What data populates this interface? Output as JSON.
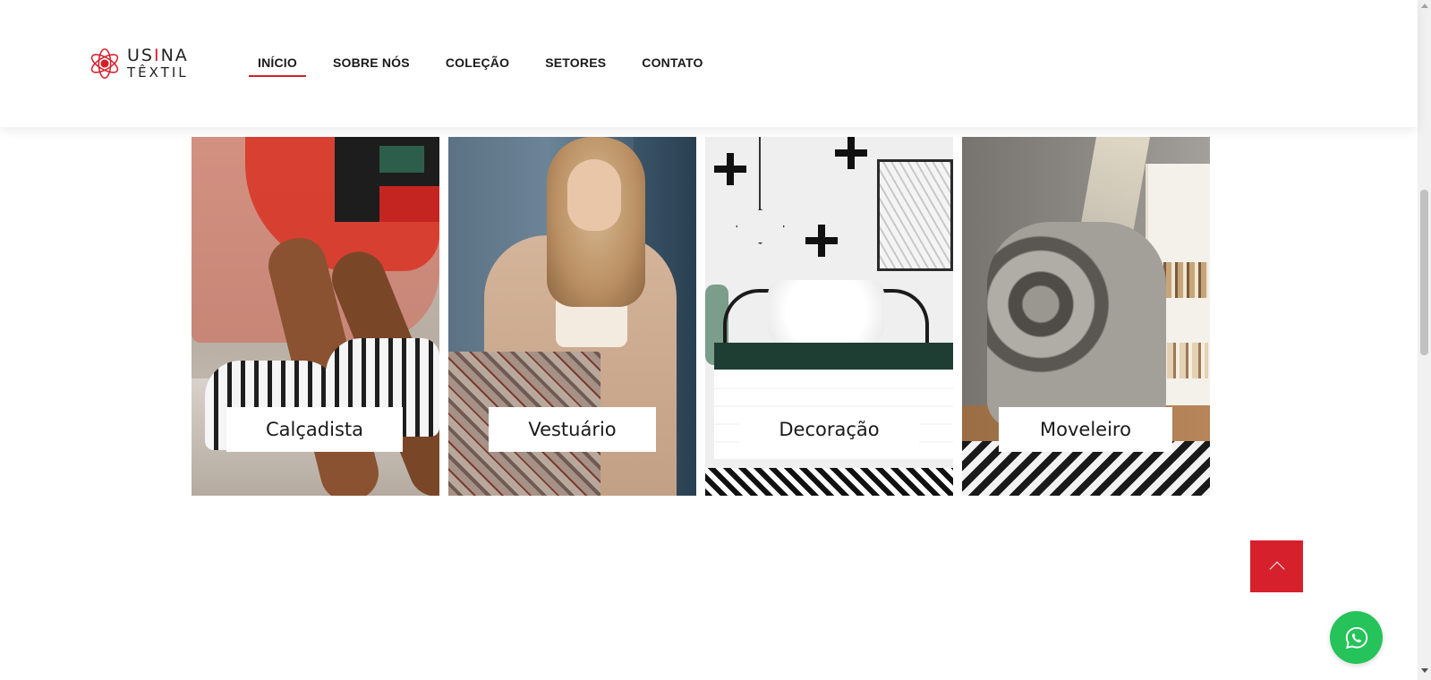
{
  "brand": {
    "line1_a": "US",
    "line1_b": "I",
    "line1_c": "NA",
    "line2": "TÊXTIL",
    "accent_color": "#d4202b"
  },
  "nav": {
    "items": [
      {
        "label": "INÍCIO",
        "active": true
      },
      {
        "label": "SOBRE NÓS",
        "active": false
      },
      {
        "label": "COLEÇÃO",
        "active": false
      },
      {
        "label": "SETORES",
        "active": false
      },
      {
        "label": "CONTATO",
        "active": false
      }
    ]
  },
  "sectors": [
    {
      "label": "Calçadista"
    },
    {
      "label": "Vestuário"
    },
    {
      "label": "Decoração"
    },
    {
      "label": "Moveleiro"
    }
  ],
  "actions": {
    "back_to_top_icon": "chevron-up-icon",
    "whatsapp_icon": "whatsapp-icon",
    "whatsapp_color": "#25c35a",
    "back_to_top_color": "#d6202b"
  }
}
